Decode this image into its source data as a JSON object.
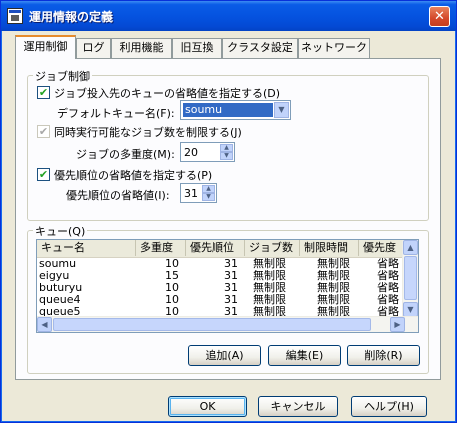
{
  "window": {
    "title": "運用情報の定義",
    "close_glyph": "✕"
  },
  "tabs": [
    {
      "label": "運用制御"
    },
    {
      "label": "ログ"
    },
    {
      "label": "利用機能"
    },
    {
      "label": "旧互換"
    },
    {
      "label": "クラスタ設定"
    },
    {
      "label": "ネットワーク"
    }
  ],
  "job_control": {
    "legend": "ジョブ制御",
    "default_queue_check": {
      "label": "ジョブ投入先のキューの省略値を指定する(D)",
      "checked": true,
      "mark": "✔"
    },
    "default_queue_label": "デフォルトキュー名(F):",
    "default_queue_value": "soumu",
    "limit_jobs_check": {
      "label": "同時実行可能なジョブ数を制限する(J)",
      "checked": true,
      "enabled": false,
      "mark": "✔"
    },
    "multiplicity_label": "ジョブの多重度(M):",
    "multiplicity_value": "20",
    "priority_check": {
      "label": "優先順位の省略値を指定する(P)",
      "checked": true,
      "mark": "✔"
    },
    "priority_label": "優先順位の省略値(I):",
    "priority_value": "31"
  },
  "queue": {
    "legend": "キュー(Q)",
    "columns": [
      "キュー名",
      "多重度",
      "優先順位",
      "ジョブ数",
      "制限時間",
      "優先度"
    ],
    "rows": [
      [
        "soumu",
        "10",
        "31",
        "無制限",
        "無制限",
        "省略"
      ],
      [
        "eigyu",
        "15",
        "31",
        "無制限",
        "無制限",
        "省略"
      ],
      [
        "buturyu",
        "10",
        "31",
        "無制限",
        "無制限",
        "省略"
      ],
      [
        "queue4",
        "10",
        "31",
        "無制限",
        "無制限",
        "省略"
      ],
      [
        "queue5",
        "10",
        "31",
        "無制限",
        "無制限",
        "省略"
      ]
    ],
    "add_button": "追加(A)",
    "edit_button": "編集(E)",
    "delete_button": "削除(R)"
  },
  "footer": {
    "ok_button": "OK",
    "cancel_button": "キャンセル",
    "help_button": "ヘルプ(H)"
  },
  "colors": {
    "title_bar": "#0553e0",
    "selection": "#316ac5",
    "dialog_bg": "#ece9d8",
    "active_tab_accent": "#e68b2c"
  }
}
